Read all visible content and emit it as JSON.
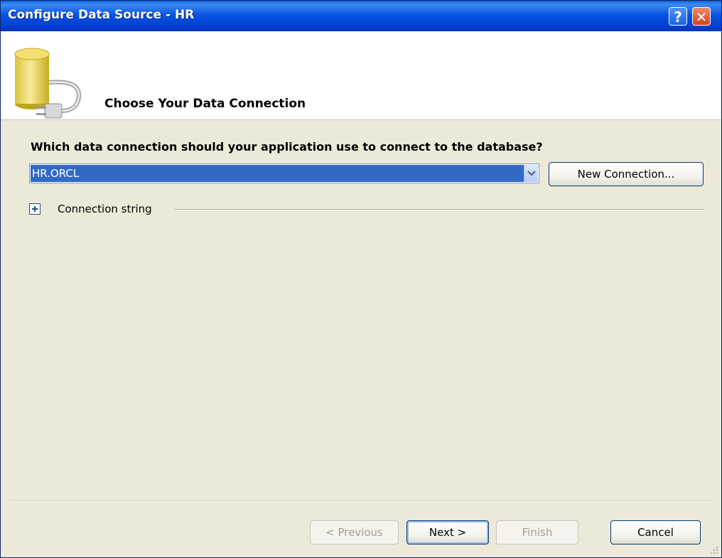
{
  "window": {
    "title": "Configure Data Source - HR",
    "help_glyph": "?",
    "close_glyph": "✕"
  },
  "header": {
    "title": "Choose Your Data Connection",
    "icon": "database-plug-icon"
  },
  "content": {
    "question": "Which data connection should your application use to connect to the database?",
    "connection_select": {
      "selected": "HR.ORCL"
    },
    "new_connection_label": "New Connection...",
    "connection_string_label": "Connection string"
  },
  "footer": {
    "previous_label": "< Previous",
    "next_label": "Next >",
    "finish_label": "Finish",
    "cancel_label": "Cancel"
  },
  "colors": {
    "titlebar": "#0b55e2",
    "dialog_bg": "#ece9d8",
    "selection": "#316ac5"
  }
}
